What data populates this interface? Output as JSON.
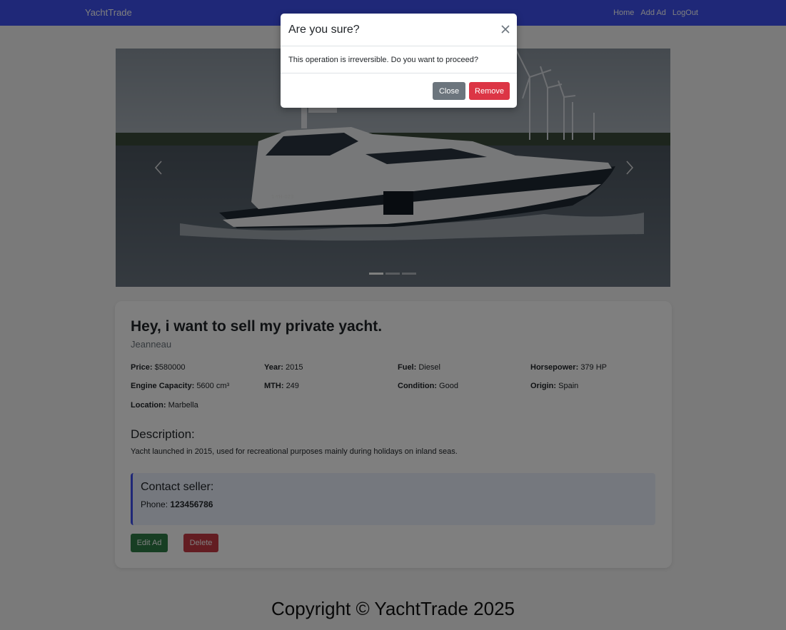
{
  "navbar": {
    "brand": "YachtTrade",
    "links": [
      "Home",
      "Add Ad",
      "LogOut"
    ],
    "color": "#3f51f0"
  },
  "carousel": {
    "image_alt": "Motor yacht cruising on inland water with wind turbines",
    "prev_icon": "chevron-left-icon",
    "next_icon": "chevron-right-icon",
    "slide_count": 3,
    "active_slide": 1
  },
  "ad": {
    "title": "Hey, i want to sell my private yacht.",
    "brand": "Jeanneau",
    "specs": [
      {
        "label": "Price:",
        "value": "$580000"
      },
      {
        "label": "Year:",
        "value": "2015"
      },
      {
        "label": "Fuel:",
        "value": "Diesel"
      },
      {
        "label": "Horsepower:",
        "value": "379 HP"
      },
      {
        "label": "Engine Capacity:",
        "value": "5600 cm³"
      },
      {
        "label": "MTH:",
        "value": "249"
      },
      {
        "label": "Condition:",
        "value": "Good"
      },
      {
        "label": "Origin:",
        "value": "Spain"
      },
      {
        "label": "Location:",
        "value": "Marbella"
      }
    ],
    "description_title": "Description:",
    "description": "Yacht launched in 2015, used for recreational purposes mainly during holidays on inland seas.",
    "contact": {
      "title": "Contact seller:",
      "phone_label": "Phone:",
      "phone": "123456786"
    },
    "buttons": {
      "edit": "Edit Ad",
      "delete": "Delete"
    }
  },
  "footer": {
    "text": "Copyright © YachtTrade 2025"
  },
  "modal": {
    "title": "Are you sure?",
    "body": "This operation is irreversible. Do you want to proceed?",
    "close_label": "Close",
    "remove_label": "Remove",
    "close_icon": "close-icon"
  },
  "colors": {
    "primary": "#3f51f0",
    "success": "#2f7d47",
    "danger": "#dc3545",
    "secondary": "#6c757d"
  }
}
